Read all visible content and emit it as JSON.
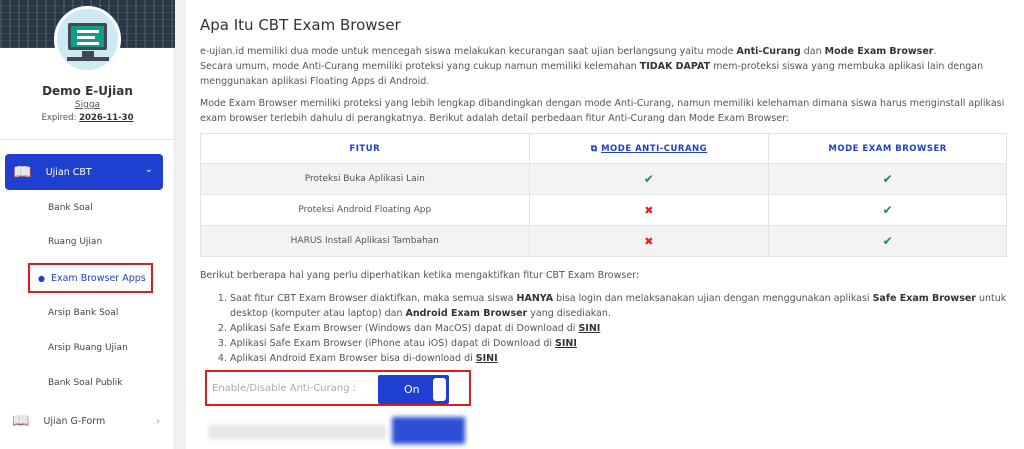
{
  "user": {
    "name": "Demo E-Ujian",
    "sub": "Sigga",
    "expired_label": "Expired:",
    "expired_date": "2026-11-30"
  },
  "sidebar": {
    "active_menu": "Ujian CBT",
    "items": [
      {
        "label": "Bank Soal"
      },
      {
        "label": "Ruang Ujian"
      },
      {
        "label": "Exam Browser Apps"
      },
      {
        "label": "Arsip Bank Soal"
      },
      {
        "label": "Arsip Ruang Ujian"
      },
      {
        "label": "Bank Soal Publik"
      }
    ],
    "gform_label": "Ujian G-Form"
  },
  "main": {
    "title": "Apa Itu CBT Exam Browser",
    "intro1_pre": "e-ujian.id memiliki dua mode untuk mencegah siswa melakukan kecurangan saat ujian berlangsung yaitu mode ",
    "intro1_b1": "Anti-Curang",
    "intro1_mid": " dan ",
    "intro1_b2": "Mode Exam Browser",
    "intro1_end": ".",
    "intro2_pre": "Secara umum, mode Anti-Curang memiliki proteksi yang cukup namun memiliki kelemahan ",
    "intro2_b": "TIDAK DAPAT",
    "intro2_end": " mem-proteksi siswa yang membuka aplikasi lain dengan menggunakan aplikasi Floating Apps di Android.",
    "intro3": "Mode Exam Browser memiliki proteksi yang lebih lengkap dibandingkan dengan mode Anti-Curang, namun memiliki kelehaman dimana siswa harus menginstall aplikasi exam browser terlebih dahulu di perangkatnya. Berikut adalah detail perbedaan fitur Anti-Curang dan Mode Exam Browser:",
    "table": {
      "headers": [
        "FITUR",
        "MODE ANTI-CURANG",
        "MODE EXAM BROWSER"
      ],
      "rows": [
        {
          "fitur": "Proteksi Buka Aplikasi Lain",
          "anti": "✔",
          "exam": "✔"
        },
        {
          "fitur": "Proteksi Android Floating App",
          "anti": "✖",
          "exam": "✔"
        },
        {
          "fitur": "HARUS Install Aplikasi Tambahan",
          "anti": "✖",
          "exam": "✔"
        }
      ]
    },
    "notes_title": "Berikut berberapa hal yang perlu diperhatikan ketika mengaktifkan fitur CBT Exam Browser:",
    "notes": [
      {
        "pre": "Saat fitur CBT Exam Browser diaktifkan, maka semua siswa ",
        "b1": "HANYA",
        "mid": " bisa login dan melaksanakan ujian dengan menggunakan aplikasi ",
        "b2": "Safe Exam Browser",
        "mid2": " untuk desktop (komputer atau laptop) dan ",
        "b3": "Android Exam Browser",
        "end": " yang disediakan."
      },
      {
        "pre": "Aplikasi Safe Exam Browser (Windows dan MacOS) dapat di Download di ",
        "link": "SINI"
      },
      {
        "pre": "Aplikasi Safe Exam Browser (iPhone atau iOS) dapat di Download di ",
        "link": "SINI"
      },
      {
        "pre": "Aplikasi Android Exam Browser bisa di-download di ",
        "link": "SINI"
      }
    ],
    "toggle_label": "Enable/Disable Anti-Curang :",
    "toggle_state": "On"
  },
  "colors": {
    "accent": "#1e3fcf",
    "highlight": "#e11a1a",
    "ok": "#1f8a4c",
    "no": "#e02424"
  }
}
